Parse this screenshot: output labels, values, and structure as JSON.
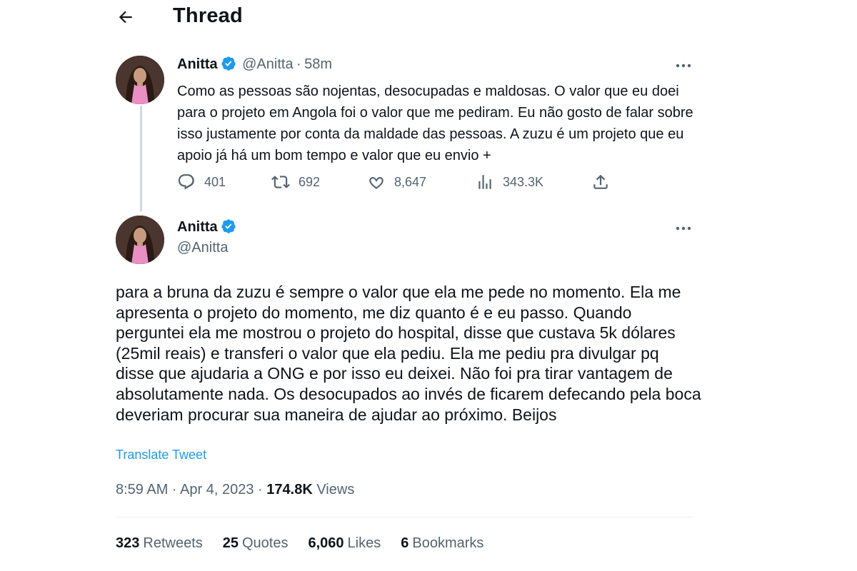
{
  "header": {
    "title": "Thread",
    "back_icon": "arrow-left-icon"
  },
  "tweet1": {
    "author_name": "Anitta",
    "handle": "@Anitta",
    "separator": "·",
    "time": "58m",
    "text": "Como as pessoas são nojentas, desocupadas e maldosas. O valor que eu doei para o projeto em Angola foi o valor que me pediram. Eu não gosto de falar sobre isso justamente por conta da maldade das pessoas. A zuzu é um projeto que eu apoio já há um bom tempo e valor que eu envio +",
    "replies": "401",
    "retweets": "692",
    "likes": "8,647",
    "views": "343.3K"
  },
  "tweet2": {
    "author_name": "Anitta",
    "handle": "@Anitta",
    "text": "para a bruna da zuzu é sempre o valor que ela me pede no momento. Ela me apresenta o projeto do momento, me diz quanto é e eu passo. Quando perguntei ela me mostrou o projeto do hospital, disse que custava 5k dólares (25mil reais) e transferi o valor que ela pediu. Ela me pediu pra divulgar pq disse que ajudaria a ONG e por isso eu deixei. Não foi pra tirar vantagem de absolutamente nada. Os desocupados ao invés de ficarem defecando pela boca deveriam procurar sua maneira de ajudar ao próximo. Beijos",
    "translate_label": "Translate Tweet",
    "timestamp": "8:59 AM · Apr 4, 2023",
    "separator": "·",
    "views_count": "174.8K",
    "views_label": "Views",
    "stats": {
      "retweets_count": "323",
      "retweets_label": "Retweets",
      "quotes_count": "25",
      "quotes_label": "Quotes",
      "likes_count": "6,060",
      "likes_label": "Likes",
      "bookmarks_count": "6",
      "bookmarks_label": "Bookmarks"
    }
  },
  "colors": {
    "accent": "#1d9bf0",
    "text": "#0f1419",
    "muted": "#536471",
    "line": "#cfd9de"
  }
}
